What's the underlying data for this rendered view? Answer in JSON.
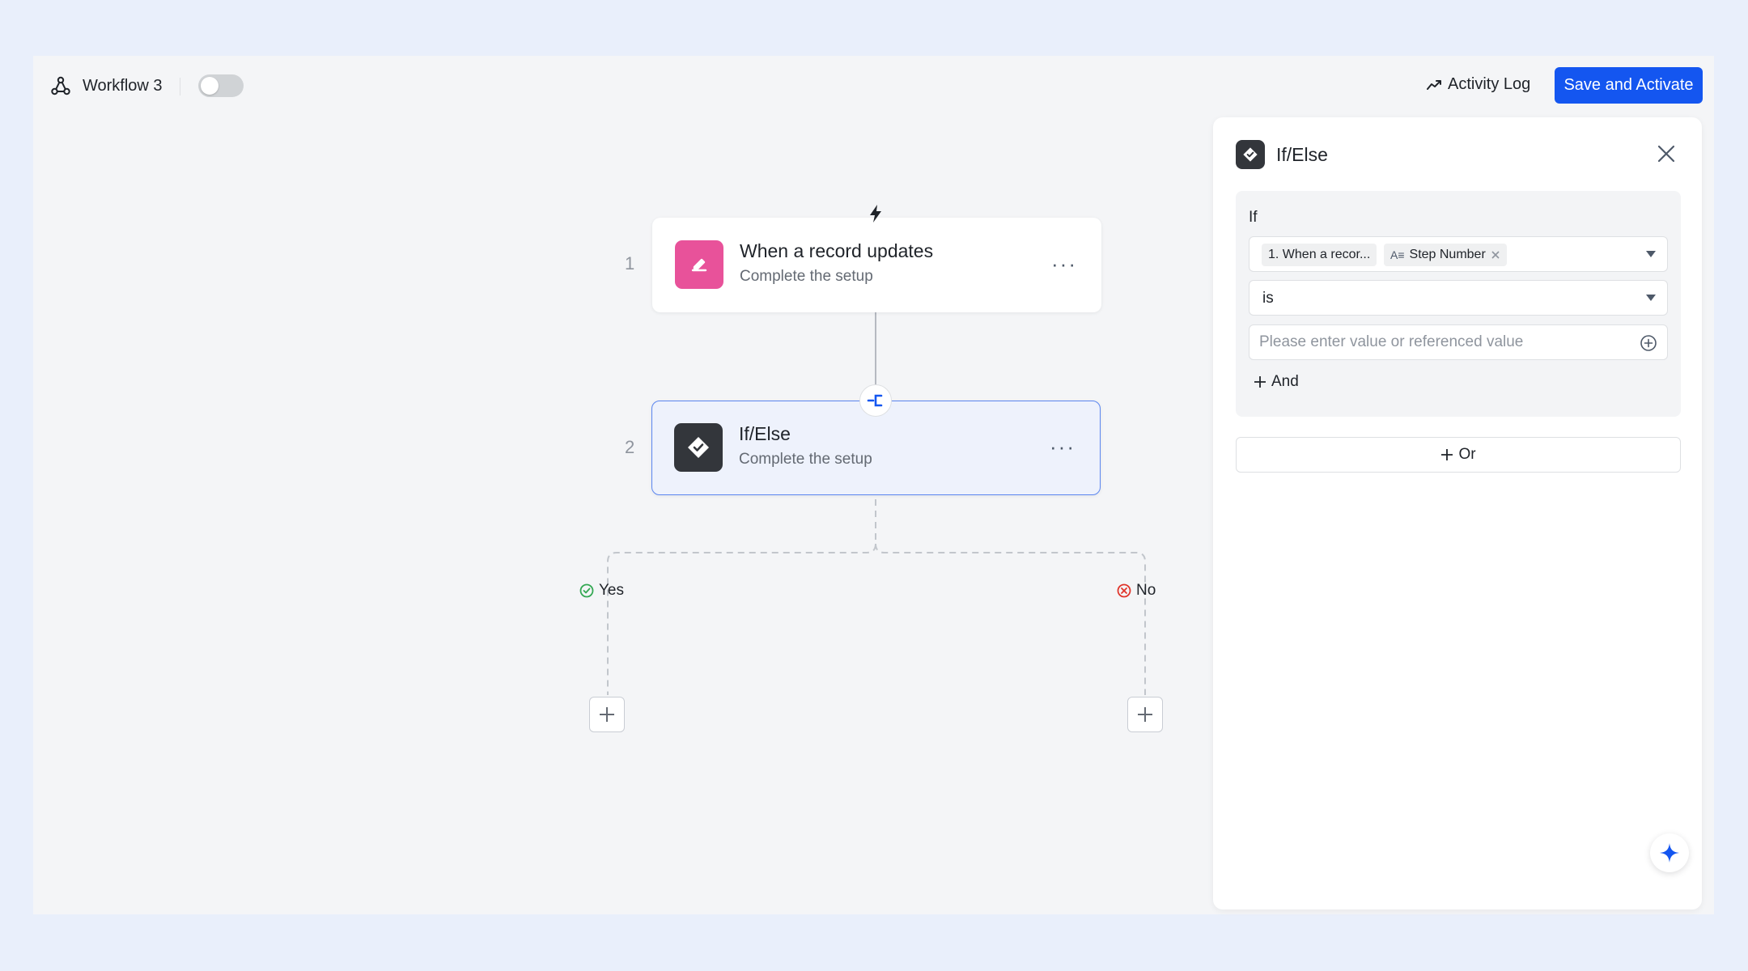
{
  "header": {
    "workflow_name": "Workflow 3",
    "toggle_enabled": false,
    "activity_log_label": "Activity Log",
    "save_label": "Save and Activate"
  },
  "canvas": {
    "nodes": [
      {
        "number": "1",
        "title": "When a record updates",
        "subtitle": "Complete the setup",
        "icon": "pencil-icon",
        "icon_color": "#e8529a"
      },
      {
        "number": "2",
        "title": "If/Else",
        "subtitle": "Complete the setup",
        "icon": "check-diamond-icon",
        "icon_color": "#33363b"
      }
    ],
    "branches": {
      "yes_label": "Yes",
      "no_label": "No"
    }
  },
  "panel": {
    "title": "If/Else",
    "if_label": "If",
    "field_chip_1": "1. When a recor...",
    "field_chip_2_icon": "A≡",
    "field_chip_2": "Step Number",
    "operator": "is",
    "value_placeholder": "Please enter value or referenced value",
    "and_label": "And",
    "or_label": "Or"
  },
  "colors": {
    "primary": "#1456f0",
    "yes_color": "#34a853",
    "no_color": "#e0362c",
    "trigger_icon_bg": "#e8529a",
    "ifelse_icon_bg": "#33363b"
  }
}
